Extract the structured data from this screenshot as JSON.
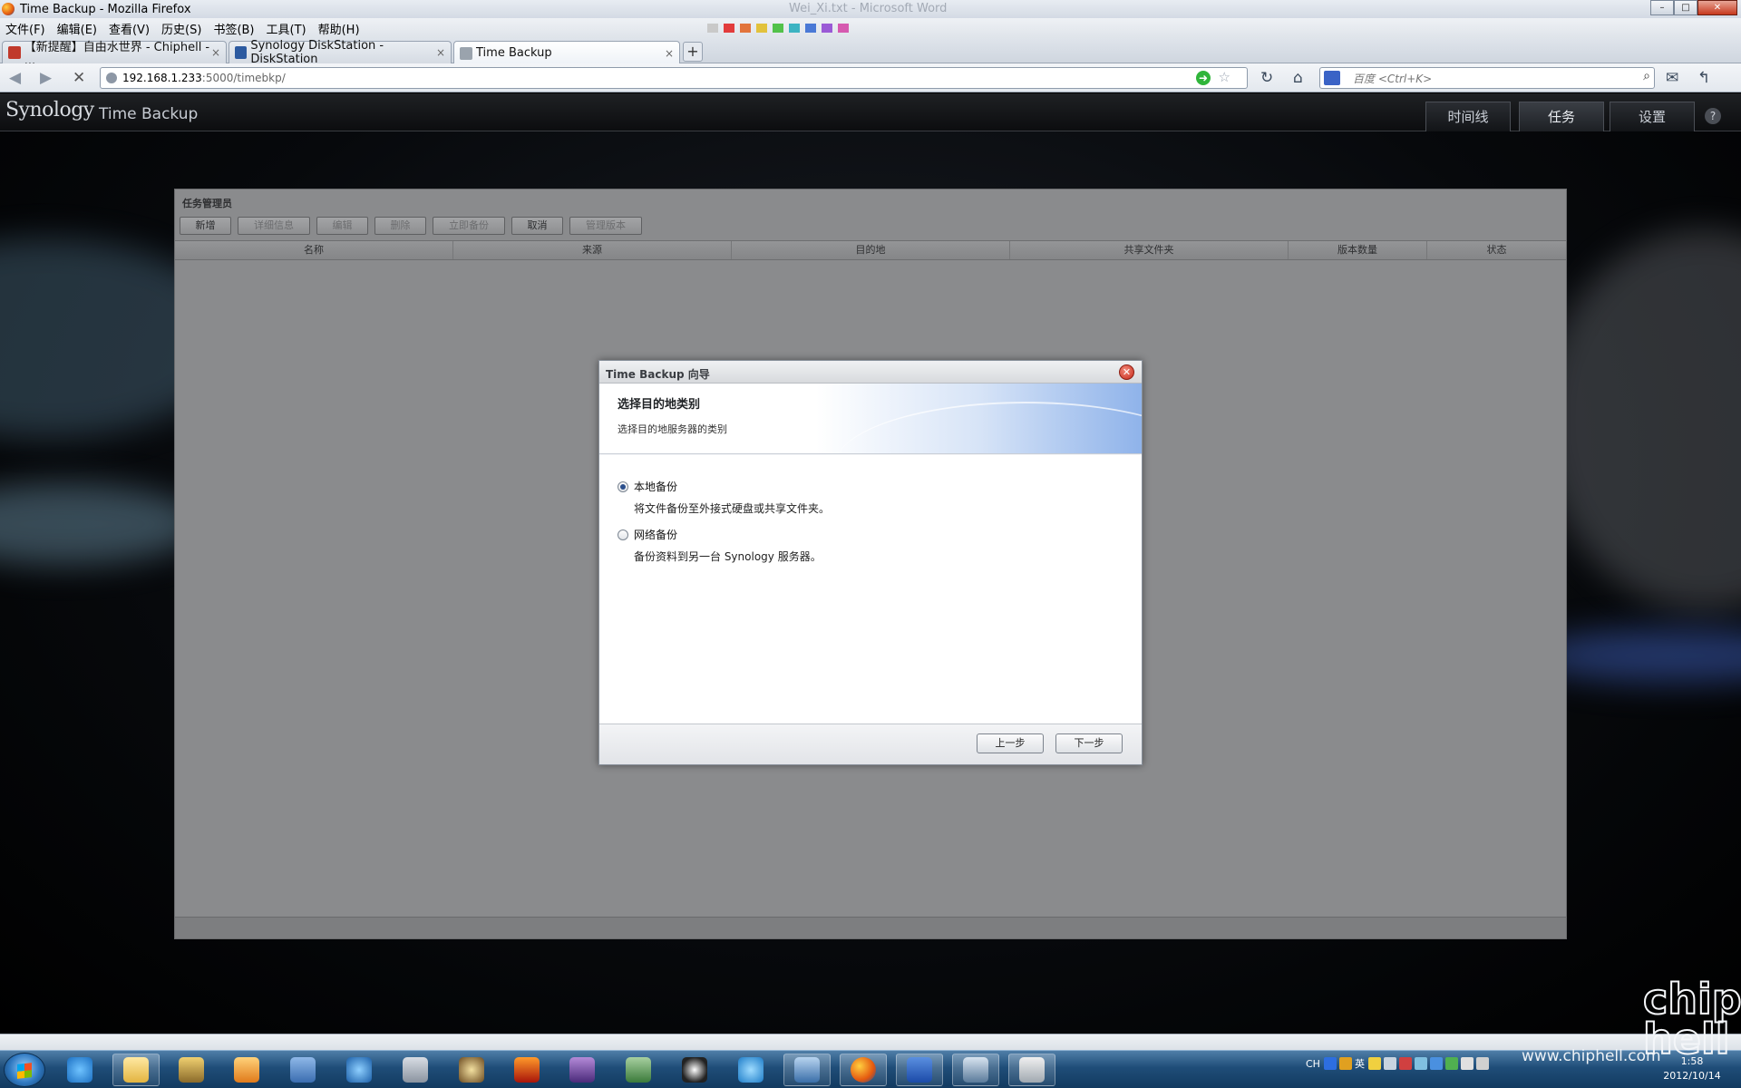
{
  "window": {
    "title": "Time Backup - Mozilla Firefox",
    "ghost_title": "Wei_Xi.txt - Microsoft Word",
    "controls": [
      "minimize",
      "maximize",
      "close"
    ]
  },
  "menubar": [
    "文件(F)",
    "编辑(E)",
    "查看(V)",
    "历史(S)",
    "书签(B)",
    "工具(T)",
    "帮助(H)"
  ],
  "tabs": [
    {
      "label": "【新提醒】自由水世界 - Chiphell - ...",
      "icon_color": "#c0392b"
    },
    {
      "label": "Synology DiskStation - DiskStation",
      "icon_color": "#2c5aa0"
    },
    {
      "label": "Time Backup",
      "icon_color": "#7f8c8d",
      "active": true
    }
  ],
  "navbar": {
    "url_host": "192.168.1.233",
    "url_rest": ":5000/timebkp/",
    "search_placeholder": "百度 <Ctrl+K>"
  },
  "app": {
    "brand": "Synology",
    "title": "Time Backup",
    "tabs": [
      "时间线",
      "任务",
      "设置"
    ],
    "active_tab": "任务",
    "help": "?"
  },
  "panel": {
    "title": "任务管理员",
    "toolbar": [
      {
        "label": "新增",
        "enabled": true
      },
      {
        "label": "详细信息",
        "enabled": false
      },
      {
        "label": "编辑",
        "enabled": false
      },
      {
        "label": "删除",
        "enabled": false
      },
      {
        "label": "立即备份",
        "enabled": false
      },
      {
        "label": "取消",
        "enabled": true
      },
      {
        "label": "管理版本",
        "enabled": false
      }
    ],
    "columns": [
      "名称",
      "来源",
      "目的地",
      "共享文件夹",
      "版本数量",
      "状态"
    ]
  },
  "dialog": {
    "title": "Time Backup 向导",
    "heading": "选择目的地类别",
    "subheading": "选择目的地服务器的类别",
    "options": [
      {
        "label": "本地备份",
        "desc": "将文件备份至外接式硬盘或共享文件夹。",
        "selected": true
      },
      {
        "label": "网络备份",
        "desc": "备份资料到另一台 Synology 服务器。",
        "selected": false
      }
    ],
    "back_label": "上一步",
    "next_label": "下一步"
  },
  "taskbar": {
    "tray_lang": "CH",
    "tray_ime": "英",
    "time": "1:58",
    "date": "2012/10/14",
    "watermark": "www.chiphell.com",
    "logo": "chip hell"
  }
}
